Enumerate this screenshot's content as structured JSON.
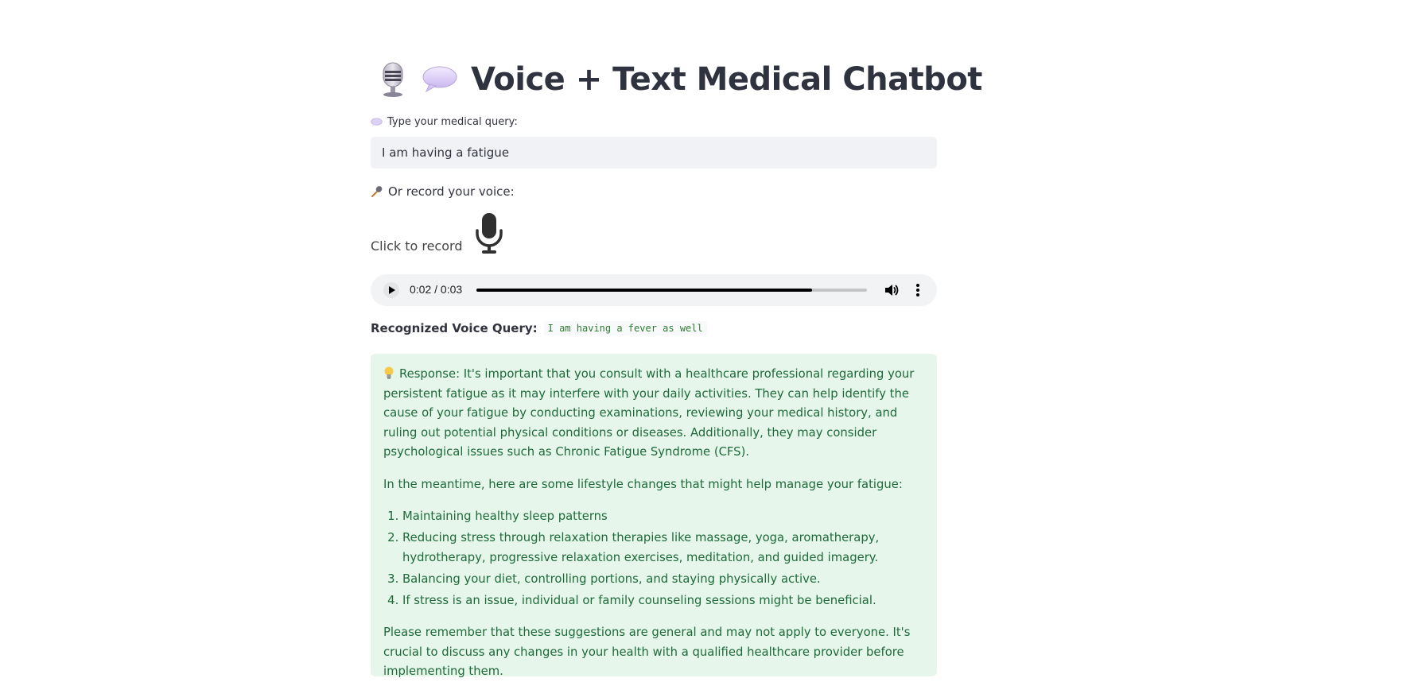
{
  "app": {
    "title": "Voice + Text Medical Chatbot",
    "title_icons": [
      "studio-microphone-icon",
      "speech-bubble-icon"
    ]
  },
  "text_query": {
    "label": "Type your medical query:",
    "label_icon": "speech-bubble-icon",
    "value": "I am having a fatigue"
  },
  "voice": {
    "label": "Or record your voice:",
    "label_icon": "microphone-icon",
    "record_text": "Click to record",
    "record_icon": "microphone-icon"
  },
  "audio_player": {
    "time": "0:02 / 0:03",
    "progress": 0.86
  },
  "recognized": {
    "label": "Recognized Voice Query:",
    "value": "I am having a fever as well"
  },
  "response": {
    "icon": "light-bulb-icon",
    "intro": "Response: It's important that you consult with a healthcare professional regarding your persistent fatigue as it may interfere with your daily activities. They can help identify the cause of your fatigue by conducting examinations, reviewing your medical history, and ruling out potential physical conditions or diseases. Additionally, they may consider psychological issues such as Chronic Fatigue Syndrome (CFS).",
    "lead": "In the meantime, here are some lifestyle changes that might help manage your fatigue:",
    "items": [
      "Maintaining healthy sleep patterns",
      "Reducing stress through relaxation therapies like massage, yoga, aromatherapy, hydrotherapy, progressive relaxation exercises, meditation, and guided imagery.",
      "Balancing your diet, controlling portions, and staying physically active.",
      "If stress is an issue, individual or family counseling sessions might be beneficial."
    ],
    "closing": "Please remember that these suggestions are general and may not apply to everyone. It's crucial to discuss any changes in your health with a qualified healthcare provider before implementing them."
  }
}
